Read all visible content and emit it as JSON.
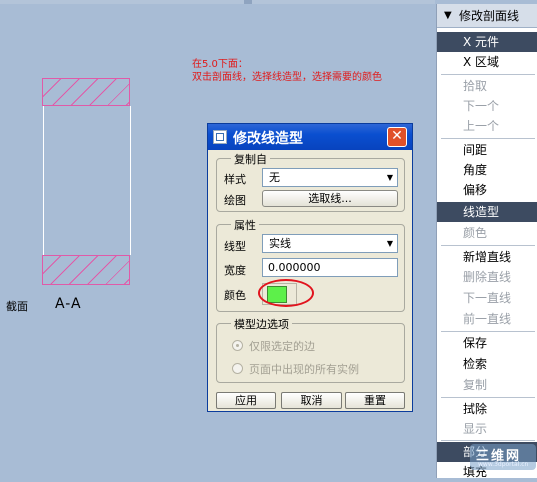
{
  "annotation": {
    "line1": "在5.0下面：",
    "line2": "双击剖面线，选择线造型，选择需要的颜色"
  },
  "drawing": {
    "section_label": "截面",
    "section_name": "A-A",
    "hatch_color": "#e05aa8"
  },
  "menu": {
    "header": "修改剖面线",
    "items": [
      {
        "label": "X 元件",
        "state": "normal"
      },
      {
        "label": "X 区域",
        "state": "normal"
      },
      {
        "label": "拾取",
        "state": "disabled"
      },
      {
        "label": "下一个",
        "state": "disabled"
      },
      {
        "label": "上一个",
        "state": "disabled"
      },
      {
        "label": "间距",
        "state": "normal"
      },
      {
        "label": "角度",
        "state": "normal"
      },
      {
        "label": "偏移",
        "state": "normal"
      },
      {
        "label": "线造型",
        "state": "selected"
      },
      {
        "label": "颜色",
        "state": "disabled"
      },
      {
        "label": "新增直线",
        "state": "normal"
      },
      {
        "label": "删除直线",
        "state": "disabled"
      },
      {
        "label": "下一直线",
        "state": "disabled"
      },
      {
        "label": "前一直线",
        "state": "disabled"
      },
      {
        "label": "保存",
        "state": "normal"
      },
      {
        "label": "检索",
        "state": "normal"
      },
      {
        "label": "复制",
        "state": "disabled"
      },
      {
        "label": "拭除",
        "state": "normal"
      },
      {
        "label": "显示",
        "state": "disabled"
      },
      {
        "label": "部分",
        "state": "selected"
      },
      {
        "label": "填充",
        "state": "normal"
      }
    ]
  },
  "dialog": {
    "title": "修改线造型",
    "copy_from": {
      "group_title": "复制自",
      "style_label": "样式",
      "style_value": "无",
      "drawing_label": "绘图",
      "select_button": "选取线..."
    },
    "attributes": {
      "group_title": "属性",
      "linetype_label": "线型",
      "linetype_value": "实线",
      "width_label": "宽度",
      "width_value": "0.000000",
      "color_label": "颜色",
      "color_value": "#5df04a"
    },
    "model_edge": {
      "group_title": "模型边选项",
      "option1": "仅限选定的边",
      "option2": "页面中出现的所有实例"
    },
    "buttons": {
      "apply": "应用",
      "cancel": "取消",
      "reset": "重置"
    }
  },
  "watermark": {
    "text": "三维网",
    "url": "www.3dportal.cn"
  }
}
